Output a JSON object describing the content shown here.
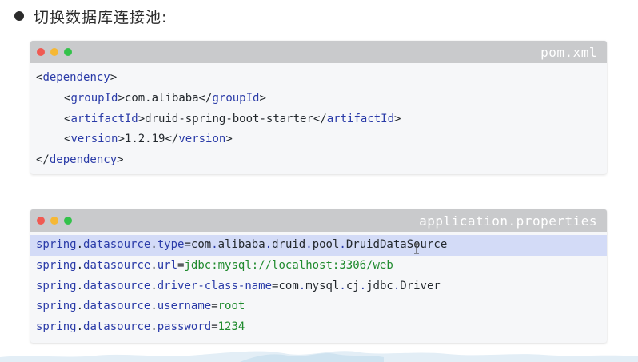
{
  "heading": {
    "text": "切换数据库连接池:"
  },
  "pom": {
    "filename": "pom.xml",
    "dependency_open_lt": "<",
    "dependency_tag": "dependency",
    "dependency_open_gt": ">",
    "groupId_tag": "groupId",
    "groupId_value": "com.alibaba",
    "artifactId_tag": "artifactId",
    "artifactId_value": "druid-spring-boot-starter",
    "version_tag": "version",
    "version_value": "1.2.19"
  },
  "app": {
    "filename": "application.properties",
    "lines": [
      {
        "key": [
          "spring",
          "datasource",
          "type"
        ],
        "value": [
          "com",
          "alibaba",
          "druid",
          "pool",
          "DruidDataSource"
        ],
        "value_color": "dark"
      },
      {
        "key": [
          "spring",
          "datasource",
          "url"
        ],
        "value_text": "jdbc:mysql://localhost:3306/web",
        "value_color": "green"
      },
      {
        "key": [
          "spring",
          "datasource",
          "driver-class-name"
        ],
        "value": [
          "com",
          "mysql",
          "cj",
          "jdbc",
          "Driver"
        ],
        "value_color": "dark"
      },
      {
        "key": [
          "spring",
          "datasource",
          "username"
        ],
        "value_text": "root",
        "value_color": "green"
      },
      {
        "key": [
          "spring",
          "datasource",
          "password"
        ],
        "value_text": "1234",
        "value_color": "green"
      }
    ]
  },
  "colors": {
    "tag": "#2a3ba8",
    "string_green": "#1f8a2e",
    "highlight": "#d3dbf7",
    "titlebar": "#c9cacc"
  },
  "icons": {
    "cursor": "text-cursor-icon",
    "window_dots": [
      "close-dot-icon",
      "minimize-dot-icon",
      "maximize-dot-icon"
    ]
  }
}
